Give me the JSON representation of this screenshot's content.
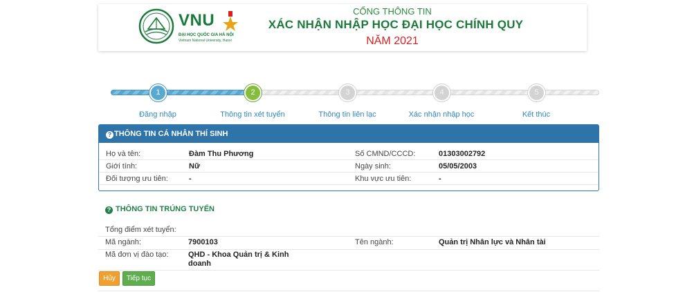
{
  "header": {
    "logo_text": "VNU",
    "logo_sub_vi": "ĐẠI HỌC QUỐC GIA HÀ NỘI",
    "logo_sub_en": "Vietnam National University, Hanoi",
    "portal_subtitle": "CỔNG THÔNG TIN",
    "portal_title": "XÁC NHẬN NHẬP HỌC ĐẠI HỌC CHÍNH QUY",
    "year": "NĂM 2021"
  },
  "stepper": {
    "progress_fraction": 0.29,
    "steps": [
      {
        "number": "1",
        "label": "Đăng nhập",
        "state": "done"
      },
      {
        "number": "2",
        "label": "Thông tin xét tuyển",
        "state": "active"
      },
      {
        "number": "3",
        "label": "Thông tin liên lạc",
        "state": "todo"
      },
      {
        "number": "4",
        "label": "Xác nhận nhập học",
        "state": "todo"
      },
      {
        "number": "5",
        "label": "Kết thúc",
        "state": "todo"
      }
    ]
  },
  "personal": {
    "title": "THÔNG TIN CÁ NHÂN THÍ SINH",
    "rows": [
      {
        "l1": "Họ và tên:",
        "v1": "Đàm Thu Phương",
        "l2": "Số CMND/CCCD:",
        "v2": "01303002792"
      },
      {
        "l1": "Giới tính:",
        "v1": "Nữ",
        "l2": "Ngày sinh:",
        "v2": "05/05/2003"
      },
      {
        "l1": "Đối tượng ưu tiên:",
        "v1": "-",
        "l2": "Khu vực ưu tiên:",
        "v2": "-"
      }
    ]
  },
  "admission": {
    "title": "THÔNG TIN TRÚNG TUYỂN",
    "total_label": "Tổng điểm xét tuyển:",
    "major_code_label": "Mã ngành:",
    "major_code": "7900103",
    "major_name_label": "Tên ngành:",
    "major_name": "Quản trị Nhân lực và Nhân tài",
    "unit_label": "Mã đơn vị đào tạo:",
    "unit_line1": "QHD - Khoa Quản trị & Kinh",
    "unit_line2": "doanh"
  },
  "buttons": {
    "cancel": "Hủy",
    "next": "Tiếp tục"
  },
  "colors": {
    "brand_green": "#1c7a3a",
    "year_red": "#d9201f",
    "panel_blue": "#2f74a8",
    "step_done": "#58a9d2",
    "step_active": "#86bd3c",
    "btn_cancel": "#f0a030",
    "btn_next": "#5fad4f"
  }
}
